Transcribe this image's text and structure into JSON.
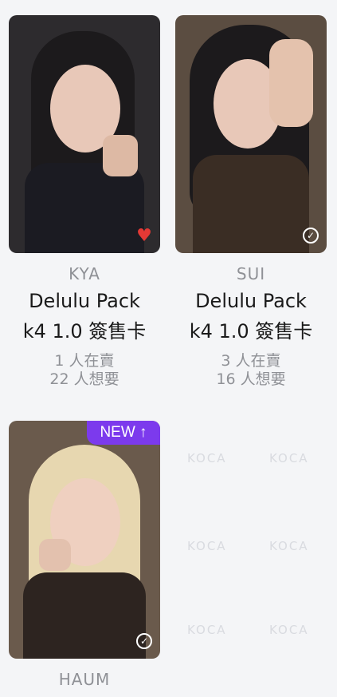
{
  "watermark_text": "KOCA",
  "cards": [
    {
      "member": "KYA",
      "title_line1": "Delulu Pack",
      "title_line2": "k4 1.0 簽售卡",
      "sellers": "1 人在賣",
      "wanters": "22 人想要",
      "indicator": "heart-icon",
      "photo_bg": "#2d2b2e"
    },
    {
      "member": "SUI",
      "title_line1": "Delulu Pack",
      "title_line2": "k4 1.0 簽售卡",
      "sellers": "3 人在賣",
      "wanters": "16 人想要",
      "indicator": "check-circle-icon",
      "photo_bg": "#5b4d41"
    },
    {
      "member": "HAUM",
      "badge": "NEW ↑",
      "indicator": "check-circle-icon",
      "photo_bg": "#6a5a4c"
    }
  ],
  "colors": {
    "accent": "#7c3aed",
    "heart": "#e53935",
    "muted": "#8f9196"
  }
}
